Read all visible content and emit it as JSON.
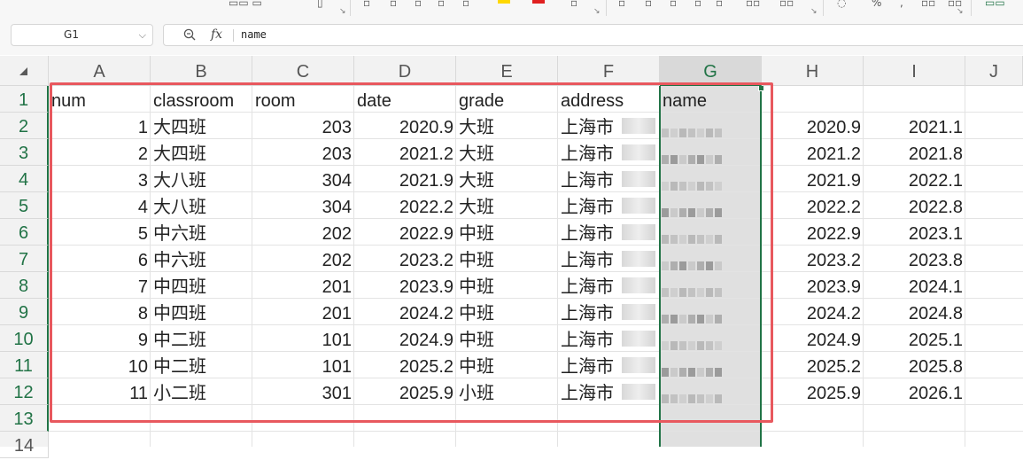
{
  "ribbon": {
    "colors": {
      "highlight": "#ffd800",
      "font_color": "#e02020"
    },
    "icons": [
      "format-painter-icon",
      "bold-icon",
      "italic-icon",
      "underline-icon",
      "border-icon",
      "fill-color-icon",
      "font-color-icon",
      "clear-format-icon",
      "align-top-icon",
      "align-middle-icon",
      "align-bottom-icon",
      "align-left-icon",
      "wrap-text-icon",
      "merge-icon",
      "number-format-icon",
      "percent-icon",
      "decimal-icon",
      "more-icon"
    ]
  },
  "name_box": {
    "value": "G1"
  },
  "formula_bar": {
    "fx": "fx",
    "content": "name"
  },
  "columns": [
    "A",
    "B",
    "C",
    "D",
    "E",
    "F",
    "G",
    "H",
    "I",
    "J"
  ],
  "rows": [
    "1",
    "2",
    "3",
    "4",
    "5",
    "6",
    "7",
    "8",
    "9",
    "10",
    "11",
    "12",
    "13",
    "14"
  ],
  "sheet": {
    "header": {
      "A": "num",
      "B": "classroom",
      "C": "room",
      "D": "date",
      "E": "grade",
      "F": "address",
      "G": "name"
    },
    "rows": [
      {
        "A": "1",
        "B": "大四班",
        "C": "203",
        "D": "2020.9",
        "E": "大班",
        "F": "上海市",
        "H": "2020.9",
        "I": "2021.1"
      },
      {
        "A": "2",
        "B": "大四班",
        "C": "203",
        "D": "2021.2",
        "E": "大班",
        "F": "上海市",
        "H": "2021.2",
        "I": "2021.8"
      },
      {
        "A": "3",
        "B": "大八班",
        "C": "304",
        "D": "2021.9",
        "E": "大班",
        "F": "上海市",
        "H": "2021.9",
        "I": "2022.1"
      },
      {
        "A": "4",
        "B": "大八班",
        "C": "304",
        "D": "2022.2",
        "E": "大班",
        "F": "上海市",
        "H": "2022.2",
        "I": "2022.8"
      },
      {
        "A": "5",
        "B": "中六班",
        "C": "202",
        "D": "2022.9",
        "E": "中班",
        "F": "上海市",
        "H": "2022.9",
        "I": "2023.1"
      },
      {
        "A": "6",
        "B": "中六班",
        "C": "202",
        "D": "2023.2",
        "E": "中班",
        "F": "上海市",
        "H": "2023.2",
        "I": "2023.8"
      },
      {
        "A": "7",
        "B": "中四班",
        "C": "201",
        "D": "2023.9",
        "E": "中班",
        "F": "上海市",
        "H": "2023.9",
        "I": "2024.1"
      },
      {
        "A": "8",
        "B": "中四班",
        "C": "201",
        "D": "2024.2",
        "E": "中班",
        "F": "上海市",
        "H": "2024.2",
        "I": "2024.8"
      },
      {
        "A": "9",
        "B": "中二班",
        "C": "101",
        "D": "2024.9",
        "E": "中班",
        "F": "上海市",
        "H": "2024.9",
        "I": "2025.1"
      },
      {
        "A": "10",
        "B": "中二班",
        "C": "101",
        "D": "2025.2",
        "E": "中班",
        "F": "上海市",
        "H": "2025.2",
        "I": "2025.8"
      },
      {
        "A": "11",
        "B": "小二班",
        "C": "301",
        "D": "2025.9",
        "E": "小班",
        "F": "上海市",
        "H": "2025.9",
        "I": "2026.1"
      }
    ]
  },
  "selection": {
    "column": "G",
    "accent": "#217346"
  },
  "annotation": {
    "color": "#e8585e"
  }
}
